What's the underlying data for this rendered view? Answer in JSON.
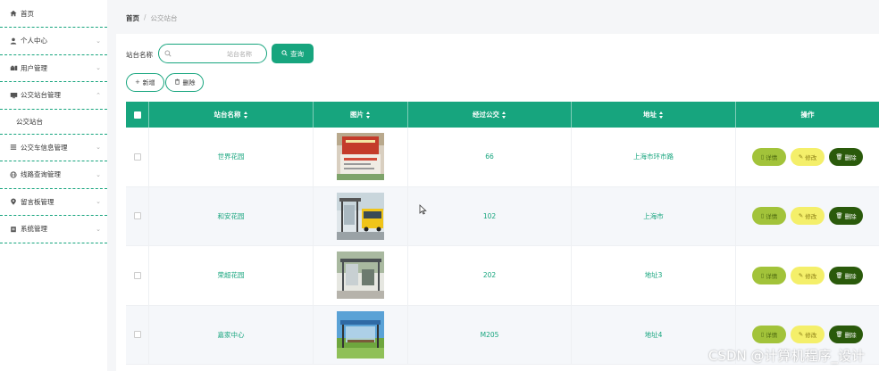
{
  "sidebar": {
    "items": [
      {
        "label": "首页",
        "icon": "home-icon",
        "has_chevron": false
      },
      {
        "label": "个人中心",
        "icon": "user-icon",
        "has_chevron": true
      },
      {
        "label": "用户管理",
        "icon": "users-icon",
        "has_chevron": true
      },
      {
        "label": "公交站台管理",
        "icon": "monitor-icon",
        "has_chevron": true,
        "expanded": true
      },
      {
        "label": "公交车信息管理",
        "icon": "list-icon",
        "has_chevron": true
      },
      {
        "label": "线路查询管理",
        "icon": "globe-icon",
        "has_chevron": true
      },
      {
        "label": "留言板管理",
        "icon": "location-icon",
        "has_chevron": true
      },
      {
        "label": "系统管理",
        "icon": "settings-icon",
        "has_chevron": true
      }
    ],
    "submenu": {
      "label": "公交站台"
    }
  },
  "breadcrumb": {
    "home": "首页",
    "separator": "/",
    "current": "公交站台"
  },
  "search": {
    "label": "站台名称",
    "placeholder": "站台名称",
    "button_label": "查询"
  },
  "actions": {
    "add_label": "新增",
    "delete_label": "删除"
  },
  "table": {
    "headers": [
      "站台名称",
      "图片",
      "经过公交",
      "地址",
      "操作"
    ],
    "rows": [
      {
        "name": "世界花园",
        "buses": "66",
        "address": "上海市环市路",
        "image": "station-sign-photo"
      },
      {
        "name": "和安花园",
        "buses": "102",
        "address": "上海市",
        "image": "bus-stop-photo"
      },
      {
        "name": "荣超花园",
        "buses": "202",
        "address": "地址3",
        "image": "bus-shelter-photo"
      },
      {
        "name": "嘉家中心",
        "buses": "M205",
        "address": "地址4",
        "image": "modern-shelter-photo"
      }
    ],
    "row_actions": {
      "detail": "详情",
      "edit": "修改",
      "delete": "删除"
    }
  },
  "watermark": "CSDN @计算机程序_设计",
  "colors": {
    "accent": "#17a57e",
    "detail": "#a2c33a",
    "edit": "#f4ef6a",
    "delete": "#2a5a0b"
  }
}
